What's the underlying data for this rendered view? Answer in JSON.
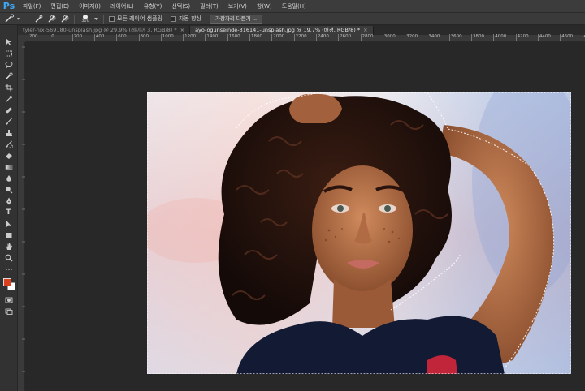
{
  "app": {
    "logo": "Ps"
  },
  "menu": [
    "파일(F)",
    "편집(E)",
    "이미지(I)",
    "레이어(L)",
    "유형(Y)",
    "선택(S)",
    "필터(T)",
    "보기(V)",
    "창(W)",
    "도움말(H)"
  ],
  "options": {
    "brush_size": "300",
    "sample_all_layers": "모든 레이어 샘플링",
    "auto_enhance": "자동 향상",
    "refine_edge": "가장자리 다듬기 ..."
  },
  "tabs": [
    {
      "label": "tyler-nix-569180-unsplash.jpg @ 29.9% (레이어 3, RGB/8) *",
      "close": "×"
    },
    {
      "label": "ayo-ogunseinde-316141-unsplash.jpg @ 19.7% (배경, RGB/8) *",
      "close": "×"
    }
  ],
  "ruler_labels": [
    "200",
    "0",
    "200",
    "400",
    "600",
    "800",
    "1000",
    "1200",
    "1400",
    "1600",
    "1800",
    "2000",
    "2200",
    "2400",
    "2600",
    "2800",
    "3000",
    "3200",
    "3400",
    "3600",
    "3800",
    "4000",
    "4200",
    "4400",
    "4600",
    "4800"
  ],
  "colors": {
    "foreground": "#d9401e",
    "background": "#ffffff",
    "accent": "#3fa9f5"
  },
  "tools": [
    "move-icon",
    "marquee-icon",
    "lasso-icon",
    "quick-selection-icon",
    "crop-icon",
    "eyedropper-icon",
    "healing-brush-icon",
    "brush-icon",
    "clone-stamp-icon",
    "history-brush-icon",
    "eraser-icon",
    "gradient-icon",
    "blur-icon",
    "dodge-icon",
    "pen-icon",
    "type-icon",
    "path-selection-icon",
    "rectangle-icon",
    "hand-icon",
    "zoom-icon"
  ],
  "tool_type_glyph": "T"
}
